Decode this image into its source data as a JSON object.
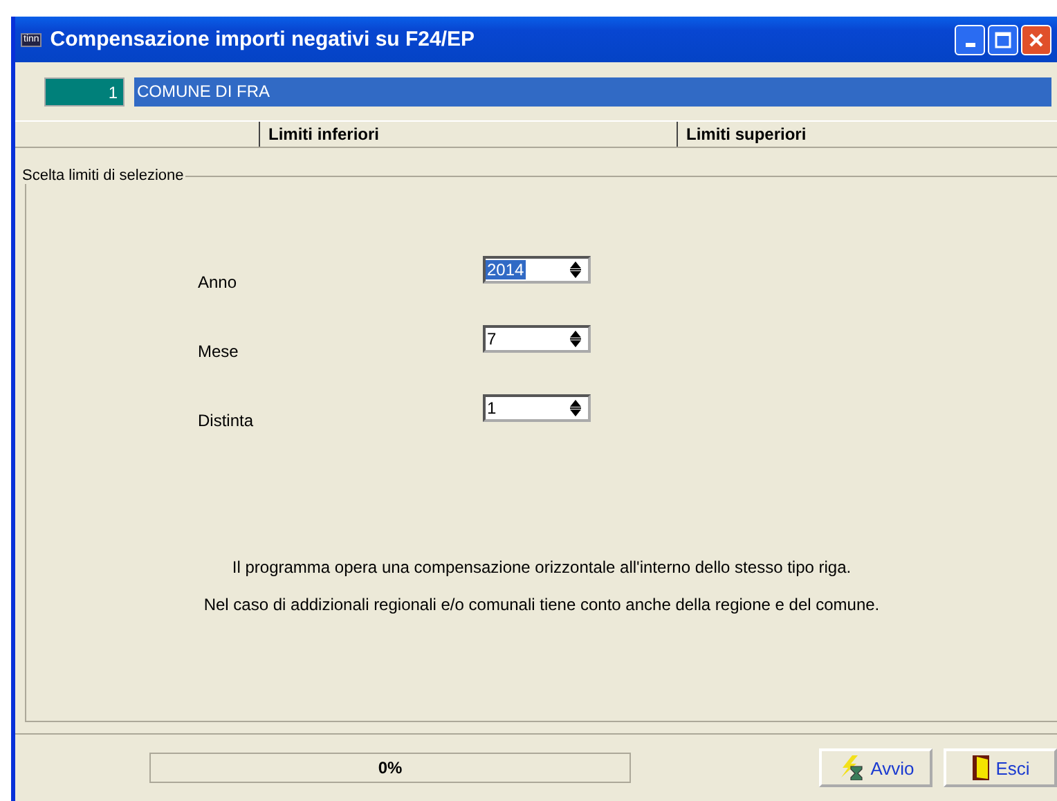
{
  "window": {
    "title": "Compensazione importi negativi su F24/EP",
    "app_badge": "tinn"
  },
  "record": {
    "code": "1",
    "name": "COMUNE DI FRA"
  },
  "header": {
    "columns": [
      "Limiti inferiori",
      "Limiti superiori"
    ]
  },
  "group": {
    "legend": "Scelta limiti di selezione",
    "fields": [
      {
        "label": "Anno",
        "value": "2014",
        "selected": true
      },
      {
        "label": "Mese",
        "value": "7",
        "selected": false
      },
      {
        "label": "Distinta",
        "value": "1",
        "selected": false
      }
    ],
    "notes": [
      "Il programma opera una compensazione orizzontale all'interno dello stesso tipo riga.",
      "Nel caso di addizionali regionali e/o comunali tiene conto anche della regione e del comune."
    ]
  },
  "progress": {
    "level": 0,
    "reading": "0%"
  },
  "buttons": [
    {
      "label": "Avvio",
      "kind": "start"
    },
    {
      "label": "Esci",
      "kind": "exit"
    }
  ]
}
